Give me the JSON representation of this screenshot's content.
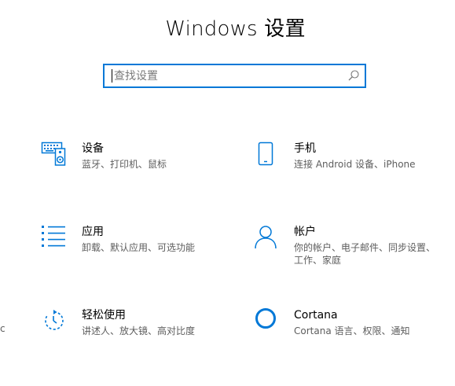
{
  "header": {
    "title": "Windows 设置"
  },
  "search": {
    "placeholder": "查找设置",
    "value": ""
  },
  "tiles": [
    {
      "id": "devices",
      "icon": "keyboard-speaker-icon",
      "title": "设备",
      "subtitle": "蓝牙、打印机、鼠标"
    },
    {
      "id": "phone",
      "icon": "phone-icon",
      "title": "手机",
      "subtitle": "连接 Android 设备、iPhone"
    },
    {
      "id": "apps",
      "icon": "app-list-icon",
      "title": "应用",
      "subtitle": "卸载、默认应用、可选功能"
    },
    {
      "id": "accounts",
      "icon": "person-icon",
      "title": "帐户",
      "subtitle": "你的帐户、电子邮件、同步设置、工作、家庭"
    },
    {
      "id": "ease",
      "icon": "ease-of-access-icon",
      "title": "轻松使用",
      "subtitle": "讲述人、放大镜、高对比度"
    },
    {
      "id": "cortana",
      "icon": "cortana-ring-icon",
      "title": "Cortana",
      "subtitle": "Cortana 语言、权限、通知"
    }
  ],
  "edge_fragment": "c",
  "colors": {
    "accent": "#0078d7",
    "subtitle_text": "#5d5d5d",
    "title_text": "#000000",
    "background": "#ffffff"
  }
}
